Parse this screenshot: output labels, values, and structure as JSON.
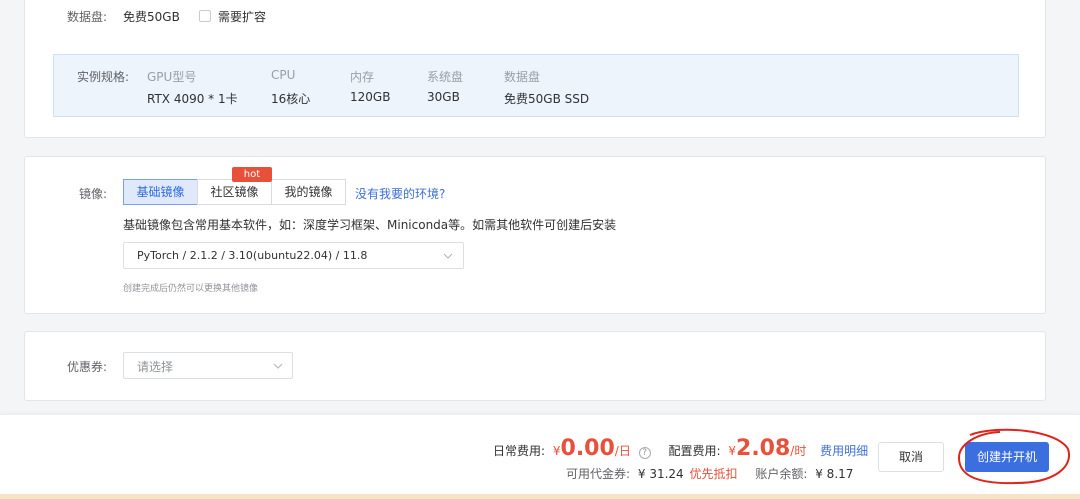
{
  "disk": {
    "label": "数据盘:",
    "value": "免费50GB",
    "expand_label": "需要扩容"
  },
  "spec": {
    "label": "实例规格:",
    "columns": [
      {
        "header": "GPU型号",
        "value": "RTX 4090 * 1卡"
      },
      {
        "header": "CPU",
        "value": "16核心"
      },
      {
        "header": "内存",
        "value": "120GB"
      },
      {
        "header": "系统盘",
        "value": "30GB"
      },
      {
        "header": "数据盘",
        "value": "免费50GB SSD"
      }
    ]
  },
  "image": {
    "label": "镜像:",
    "tabs": [
      "基础镜像",
      "社区镜像",
      "我的镜像"
    ],
    "hot_badge": "hot",
    "missing_link": "没有我要的环境?",
    "description": "基础镜像包含常用基本软件，如：深度学习框架、Miniconda等。如需其他软件可创建后安装",
    "selected": "PyTorch / 2.1.2 / 3.10(ubuntu22.04) / 11.8",
    "hint": "创建完成后仍然可以更换其他镜像"
  },
  "coupon": {
    "label": "优惠券:",
    "placeholder": "请选择"
  },
  "footer": {
    "daily_label": "日常费用:",
    "currency": "¥",
    "daily_value": "0.00",
    "daily_unit": "/日",
    "config_label": "配置费用:",
    "config_value": "2.08",
    "config_unit": "/时",
    "detail_link": "费用明细",
    "voucher_label": "可用代金券:",
    "voucher_value": "¥ 31.24",
    "voucher_note": "优先抵扣",
    "balance_label": "账户余额:",
    "balance_value": "¥ 8.17",
    "cancel_label": "取消",
    "create_label": "创建并开机"
  },
  "colors": {
    "accent": "#3b6fe0",
    "price": "#e8503a",
    "annotation": "#e0241c"
  }
}
